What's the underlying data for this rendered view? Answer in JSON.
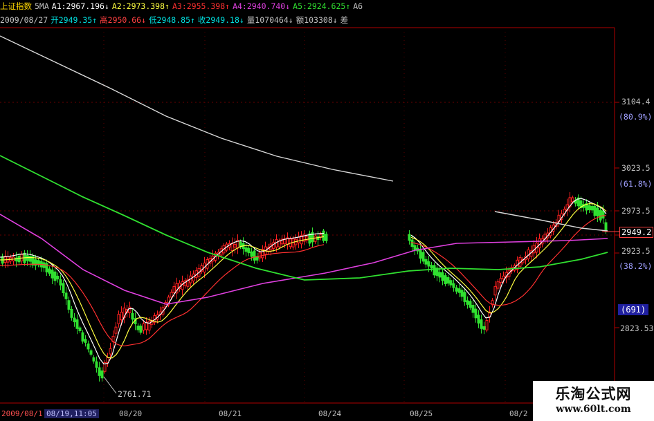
{
  "header": {
    "line1": [
      {
        "text": "上证指数",
        "color": "#ffd800"
      },
      {
        "text": "5MA",
        "color": "#c0c0c0"
      },
      {
        "text": "A1:2967.196↓",
        "color": "#ffffff"
      },
      {
        "text": "A2:2973.398↑",
        "color": "#ffff40"
      },
      {
        "text": "A3:2955.398↑",
        "color": "#ff3030"
      },
      {
        "text": "A4:2940.740↓",
        "color": "#e040e0"
      },
      {
        "text": "A5:2924.625↑",
        "color": "#30e030"
      },
      {
        "text": "A6",
        "color": "#c0c0c0"
      }
    ],
    "line2": [
      {
        "text": "2009/08/27",
        "color": "#c0c0c0"
      },
      {
        "text": "开2949.35↑",
        "color": "#00e0e0"
      },
      {
        "text": "高2950.66↓",
        "color": "#ff4040"
      },
      {
        "text": "低2948.85↑",
        "color": "#00e0e0"
      },
      {
        "text": "收2949.18↓",
        "color": "#00e0e0"
      },
      {
        "text": "量1070464↓",
        "color": "#c0c0c0"
      },
      {
        "text": "额103308↓",
        "color": "#c0c0c0"
      },
      {
        "text": "差",
        "color": "#c0c0c0"
      }
    ]
  },
  "price_axis": [
    {
      "text": "3104.4",
      "color": "#c0c0c0"
    },
    {
      "text": "(80.9%)",
      "color": "#a0a0ff"
    },
    {
      "text": "3023.5",
      "color": "#c0c0c0"
    },
    {
      "text": "(61.8%)",
      "color": "#a0a0ff"
    },
    {
      "text": "2973.5",
      "color": "#c0c0c0"
    },
    {
      "text": "2923.5",
      "color": "#c0c0c0"
    },
    {
      "text": "(38.2%)",
      "color": "#a0a0ff"
    },
    {
      "text": "2823.53",
      "color": "#c0c0c0"
    }
  ],
  "current_price": "2949.2",
  "volume_box": "(691)",
  "low_marker": "2761.71",
  "dates": [
    "08/20",
    "08/21",
    "08/24",
    "08/25",
    "08/2"
  ],
  "bottom_info": {
    "date_left": "2009/08/1",
    "time": "08/19,11:05"
  },
  "watermark": {
    "title": "乐淘公式网",
    "url": "www.60lt.com"
  },
  "colors": {
    "up": "#ff2020",
    "down": "#30e030",
    "ma1": "#ffffff",
    "ma2": "#ffff40",
    "ma3": "#ff3030",
    "ma4": "#e040e0",
    "ma5": "#30e030",
    "ma_long": "#d8d8d8"
  },
  "chart_data": {
    "type": "candlestick",
    "title": "上证指数",
    "ylim": [
      2761.71,
      3104.4
    ],
    "yticks": [
      3104.4,
      3023.5,
      2973.5,
      2923.5,
      2823.53
    ],
    "fib_levels": [
      "80.9%",
      "61.8%",
      "38.2%"
    ],
    "xticks": [
      "08/20",
      "08/21",
      "08/24",
      "08/25",
      "08/2"
    ],
    "low_annotation": 2761.71,
    "current": 2949.2
  }
}
